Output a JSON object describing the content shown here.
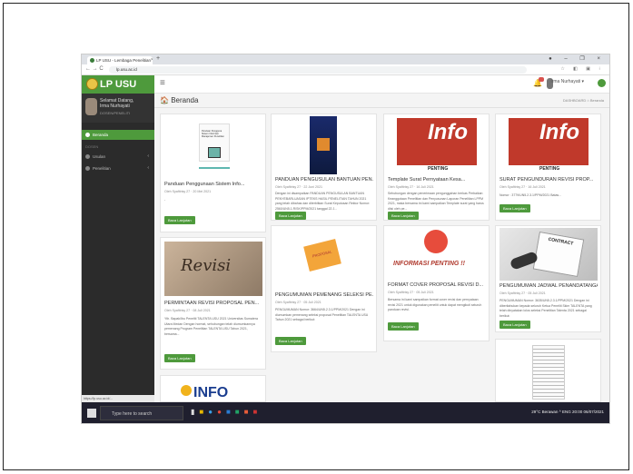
{
  "browser": {
    "tab_title": "LP USU - Lembaga Penelitian",
    "tab_close": "×",
    "new_tab": "+",
    "window_controls": "●  –  ❐  ×",
    "nav_buttons": "←  →  C",
    "url": "lp.usu.ac.id",
    "toolbar_icons": "☆ ◧ ▣ ⁝"
  },
  "app": {
    "brand": "LP USU",
    "user_label": "Irma Nurhayati ▾",
    "breadcrumb": "DASHBOARD   ⌂ Beranda"
  },
  "sidebar": {
    "user_name": "Selamat Datang,\nIrma Nurhayati",
    "user_role": "DOSEN/PENELITI",
    "items": [
      {
        "label": "Beranda",
        "active": true
      },
      {
        "label": "Usulan",
        "active": false
      },
      {
        "label": "Penelitian",
        "active": false
      }
    ],
    "section": "DOSEN"
  },
  "page": {
    "title": "Beranda"
  },
  "cards": [
    {
      "title": "Panduan Penggunaan Sistem Info...",
      "meta": "Oleh Syafitrisy 27 · 20 Mei 2021",
      "body": "-",
      "button": "Baca Lanjutan"
    },
    {
      "title": "PANDUAN PENGUSULAN BANTUAN PEN...",
      "meta": "Oleh Syafitrisy 27 · 22 Juni 2021",
      "body": "Dengan ini disampaikan PANDUAN PENGUSULAN BANTUAN PENYEBARLUASAN IPTEKS HASIL PENELITIAN TAHUN 2021 yang telah dibahas dan diterbitkan Surat Keputusan Rektor Nomor: 2560/UN5.1.R/SK/PPM/2021 tanggal 22 J...",
      "button": "Baca Lanjutan"
    },
    {
      "title": "Template Surat Pernyataan Kesa...",
      "meta": "Oleh Syafitrisy 27 · 16 Juli 2021",
      "body": "Sehubungan dengan penerimaan pengunggahan berkas Perbaikan Keanggotaan Penelitian dan Penyusunan Laporan Penelitian LPPM 2021, maka bersama ini kami sampaikan Template surat yang harus diisi oleh pe...",
      "button": "Baca Lanjutan"
    },
    {
      "title": "SURAT PENGUNDURAN REVISI PROP...",
      "meta": "Oleh Syafitrisy 27 · 16 Juli 2021",
      "body": "Nomor : 3779/UN5.2.3.1/PPM/2021          Batas...",
      "button": "Baca Lanjutan"
    },
    {
      "title": "PERMINTAAN REVISI PROPOSAL PEN...",
      "meta": "Oleh Syafitrisy 27 · 08 Juli 2021",
      "body": "Yth. Bapak/Ibu Peneliti TALENTA USU 2021 Universitas Sumatera Utara Medan Dengan hormat, sehubungan telah diumumkannya pemenang Program Penelitian TALENTA USU Tahun 2021, bersama...",
      "button": "Baca Lanjutan"
    },
    {
      "title": "PENGUMUMAN PEMENANG SELEKSI PE...",
      "meta": "Oleh Syafitrisy 27 · 05 Juli 2021",
      "body": "PENGUMUMAN Nomor: 3664/UN5.2.3.1/PPM/2021     Dengan ini diumumkan pemenang seleksi proposal Penelitian TALENTA USU Tahun 2021 sebagai berikut:",
      "button": "Baca Lanjutan"
    },
    {
      "title": "FORMAT COVER PROPOSAL REVISI D...",
      "meta": "Oleh Syafitrisy 27 · 05 Juli 2021",
      "body": "Bersama ini kami sampaikan format cover revisi dan pernyataan revisi 2021 untuk digunakan peneliti untuk dapat mengikuti seluruh panduan revisi.",
      "button": "Baca Lanjutan"
    },
    {
      "title": "PENGUMUMAN JADWAL PENANDATANGA...",
      "meta": "Oleh Syafitrisy 27 · 05 Juli 2021",
      "body": "PENGUMUMAN Nomor: 3635/UN5.2.3.1/PPM/2021     Dengan ini diberitahukan kepada seluruh Ketua Peneliti Skim TALENTA yang telah dinyatakan lolos seleksi Penelitian Talenta 2021 sebagai berikut:",
      "button": "Baca Lanjutan"
    }
  ],
  "thumbs": {
    "info1": "Info",
    "info1_sub": "PENTING",
    "info2": "Info",
    "info2_sub": "PENTING",
    "revisi": "Revisi",
    "proposal": "PROPOSAL",
    "info_penting": "INFORMASI PENTING !!",
    "contract": "CONTRACT",
    "info_bottom": "INFO",
    "cover_line1": "Panduan Pengguna",
    "cover_line2": "Sistem Informasi",
    "cover_line3": "Manajemen Penelitian"
  },
  "status_url": "https://lp.usu.ac.id/...",
  "taskbar": {
    "search_placeholder": "Type here to search",
    "tray": "29°C Berawan  ^  ENG  20:00  06/07/2021"
  },
  "colors": {
    "brand": "#4e9a3c",
    "sidebar": "#2b2b2b",
    "accent_red": "#c0392b"
  }
}
